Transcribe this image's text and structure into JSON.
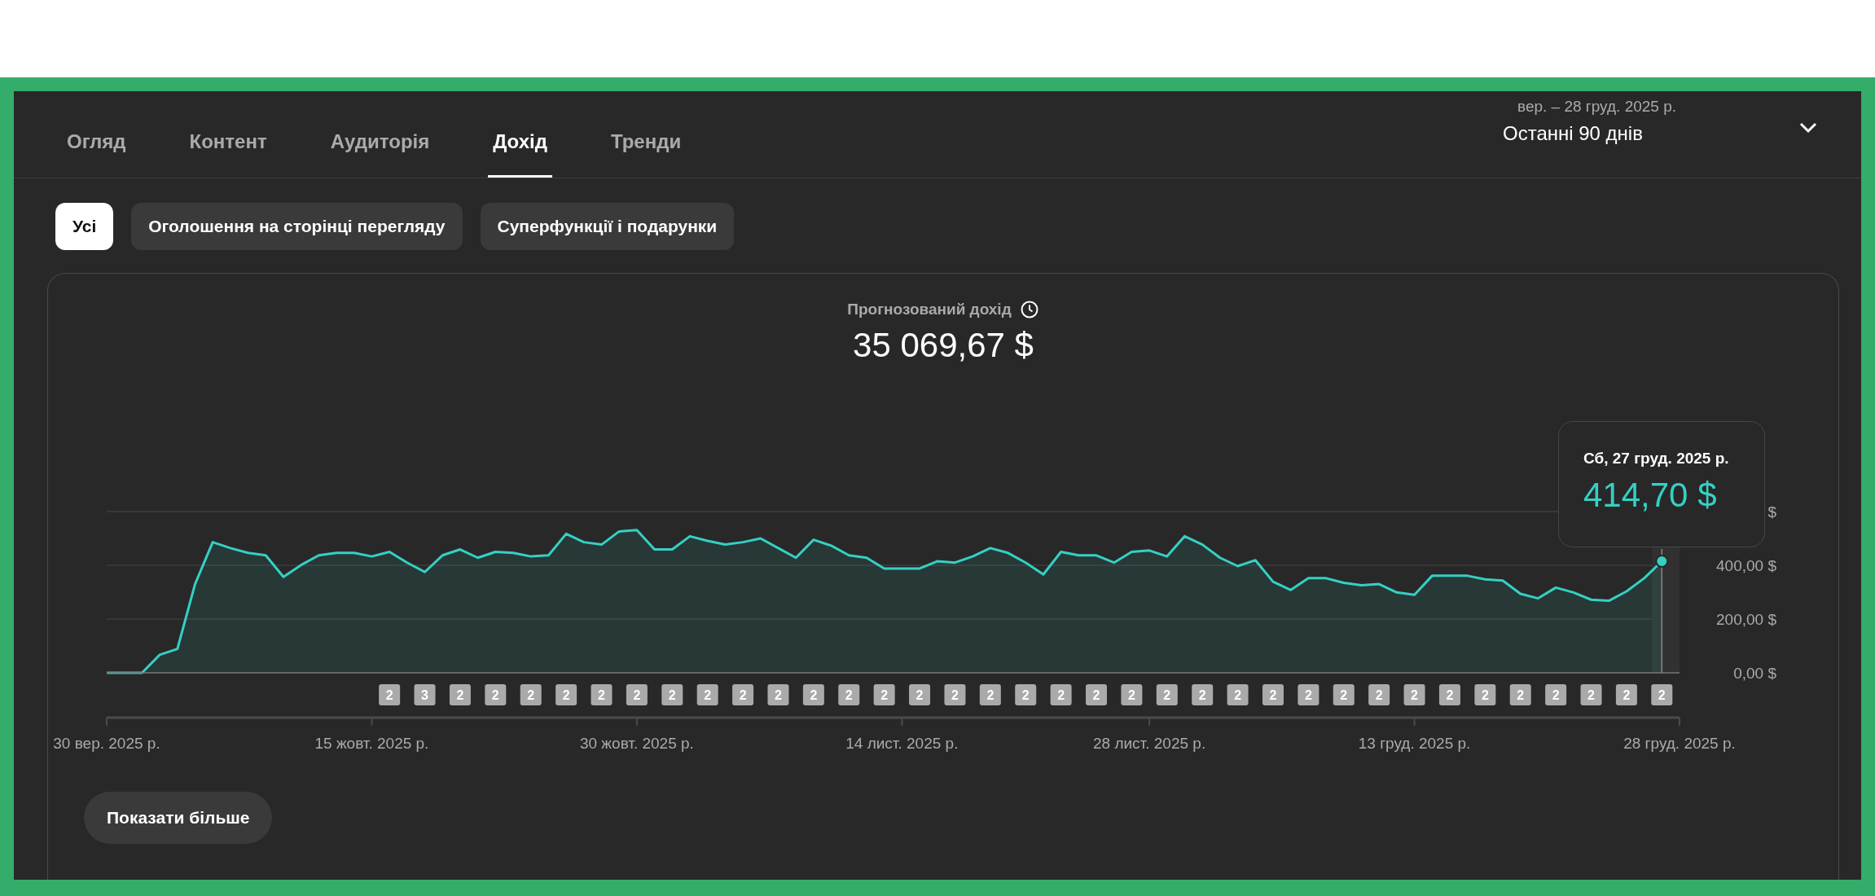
{
  "tabs": [
    {
      "label": "Огляд",
      "selected": false
    },
    {
      "label": "Контент",
      "selected": false
    },
    {
      "label": "Аудиторія",
      "selected": false
    },
    {
      "label": "Дохід",
      "selected": true
    },
    {
      "label": "Тренди",
      "selected": false
    }
  ],
  "date_range": {
    "dates": "вер. – 28 груд. 2025 р.",
    "label": "Останні 90 днів"
  },
  "filters": [
    {
      "label": "Усі",
      "selected": true
    },
    {
      "label": "Оголошення на сторінці перегляду",
      "selected": false
    },
    {
      "label": "Суперфункції і подарунки",
      "selected": false
    }
  ],
  "revenue": {
    "title": "Прогнозований дохід",
    "value": "35 069,67 $",
    "chart_data": {
      "type": "area",
      "ylim": [
        0,
        600
      ],
      "categories": [
        "30 вер. 2025 р.",
        null,
        null,
        null,
        null,
        null,
        null,
        null,
        null,
        null,
        null,
        null,
        null,
        null,
        null,
        "15 жовт. 2025 р.",
        null,
        null,
        null,
        null,
        null,
        null,
        null,
        null,
        null,
        null,
        null,
        null,
        null,
        null,
        "30 жовт. 2025 р.",
        null,
        null,
        null,
        null,
        null,
        null,
        null,
        null,
        null,
        null,
        null,
        null,
        null,
        null,
        "14 лист. 2025 р.",
        null,
        null,
        null,
        null,
        null,
        null,
        null,
        null,
        null,
        null,
        null,
        null,
        null,
        "28 лист. 2025 р.",
        null,
        null,
        null,
        null,
        null,
        null,
        null,
        null,
        null,
        null,
        null,
        null,
        null,
        null,
        "13 груд. 2025 р.",
        null,
        null,
        null,
        null,
        null,
        null,
        null,
        null,
        null,
        null,
        null,
        null,
        null,
        null,
        "28 груд. 2025 р."
      ],
      "series": [
        {
          "color": "#35d0c4",
          "values": [
            0,
            0,
            0,
            67,
            89,
            330,
            486,
            464,
            446,
            437,
            357,
            401,
            437,
            446,
            446,
            433,
            450,
            410,
            375,
            437,
            459,
            428,
            450,
            446,
            433,
            437,
            517,
            486,
            477,
            526,
            531,
            459,
            459,
            508,
            491,
            477,
            486,
            500,
            464,
            428,
            495,
            473,
            437,
            428,
            388,
            388,
            388,
            415,
            410,
            433,
            464,
            446,
            410,
            366,
            450,
            437,
            437,
            410,
            450,
            455,
            433,
            508,
            477,
            428,
            397,
            419,
            339,
            308,
            352,
            352,
            335,
            326,
            330,
            299,
            290,
            361,
            361,
            361,
            348,
            343,
            294,
            277,
            317,
            299,
            272,
            268,
            303,
            352,
            415,
            null
          ]
        }
      ],
      "yticks": [
        {
          "value": 0,
          "label": "0,00 $"
        },
        {
          "value": 200,
          "label": "200,00 $"
        },
        {
          "value": 400,
          "label": "400,00 $"
        },
        {
          "value": 600,
          "label": "$"
        }
      ]
    },
    "markers": [
      "2",
      "3",
      "2",
      "2",
      "2",
      "2",
      "2",
      "2",
      "2",
      "2",
      "2",
      "2",
      "2",
      "2",
      "2",
      "2",
      "2",
      "2",
      "2",
      "2",
      "2",
      "2",
      "2",
      "2",
      "2",
      "2",
      "2",
      "2",
      "2",
      "2",
      "2",
      "2",
      "2",
      "2",
      "2",
      "2",
      "2"
    ],
    "tooltip": {
      "date": "Сб, 27 груд. 2025 р.",
      "value": "414,70 $"
    }
  },
  "show_more_button": "Показати більше"
}
